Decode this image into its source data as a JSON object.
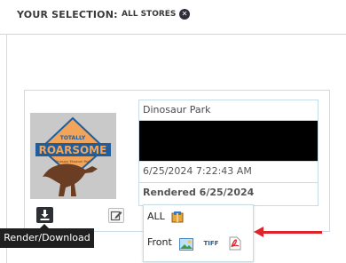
{
  "selection": {
    "label": "YOUR SELECTION:",
    "chip_label": "ALL STORES",
    "clear_symbol": "✕"
  },
  "card": {
    "thumbnail_logo": {
      "line1": "TOTALLY",
      "line2": "ROARSOME",
      "line3": "Dinosaur Museum Park"
    },
    "title": "Dinosaur Park",
    "timestamp": "6/25/2024 7:22:43 AM",
    "rendered": "Rendered 6/25/2024"
  },
  "actions": {
    "download_icon": "download-icon",
    "edit_icon": "edit-icon",
    "tooltip": "Render/Download"
  },
  "popup": {
    "all_label": "ALL",
    "front_label": "Front",
    "icons": [
      "zip-package-icon",
      "jpg-image-icon",
      "tiff-icon",
      "pdf-icon"
    ],
    "tiff_text": "TIFF"
  },
  "colors": {
    "accent_arrow": "#e0232b",
    "card_border": "#c8dbe8",
    "logo_orange": "#f2a45a",
    "logo_blue": "#1f5e9e",
    "dino_brown": "#6b3d22"
  }
}
